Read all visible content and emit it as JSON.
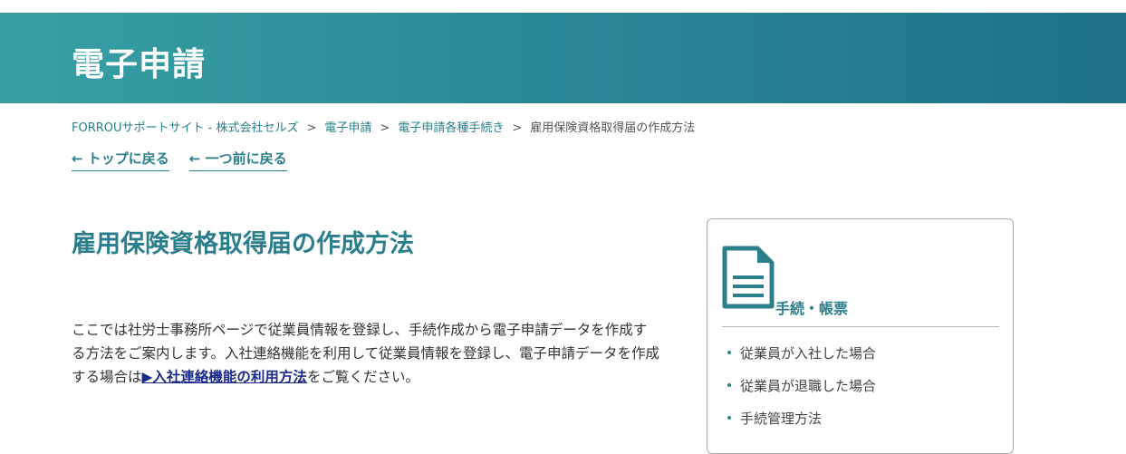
{
  "banner": {
    "title": "電子申請"
  },
  "breadcrumb": {
    "items": [
      "FORROUサポートサイト - 株式会社セルズ",
      "電子申請",
      "電子申請各種手続き"
    ],
    "current": "雇用保険資格取得届の作成方法",
    "separator": ">"
  },
  "back_links": {
    "top": "← トップに戻る",
    "prev": "← 一つ前に戻る"
  },
  "article": {
    "title": "雇用保険資格取得届の作成方法",
    "intro_before": "ここでは社労士事務所ページで従業員情報を登録し、手続作成から電子申請データを作成する方法をご案内します。入社連絡機能を利用して従業員情報を登録し、電子申請データを作成する場合は",
    "intro_link": "▶入社連絡機能の利用方法",
    "intro_after": "をご覧ください。"
  },
  "sidebar": {
    "icon": "document-icon",
    "title": "手続・帳票",
    "items": [
      "従業員が入社した場合",
      "従業員が退職した場合",
      "手続管理方法"
    ]
  },
  "colors": {
    "accent": "#2b7f8c",
    "banner_start": "#37a0a4",
    "banner_end": "#1f7289",
    "link": "#1a2a8a"
  }
}
